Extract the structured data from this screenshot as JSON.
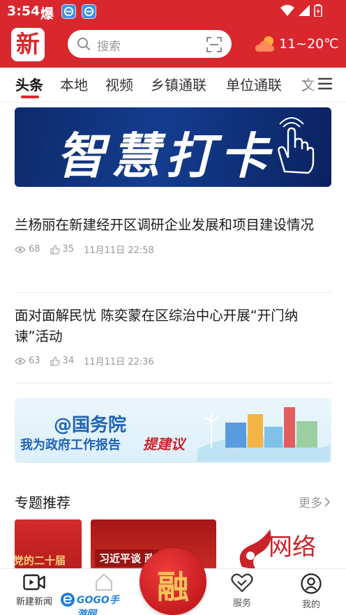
{
  "status": {
    "time": "3:54",
    "status_char": "爆"
  },
  "header": {
    "logo_char": "新",
    "search": {
      "placeholder": "搜索"
    },
    "weather": {
      "text": "11~20℃"
    }
  },
  "tabs": [
    {
      "label": "头条",
      "active": true
    },
    {
      "label": "本地"
    },
    {
      "label": "视频"
    },
    {
      "label": "乡镇通联"
    },
    {
      "label": "单位通联"
    },
    {
      "label": "文"
    }
  ],
  "banner_top": {
    "text": "智慧打卡"
  },
  "news": [
    {
      "title": "兰杨丽在新建经开区调研企业发展和项目建设情况",
      "views": "68",
      "likes": "35",
      "time": "11月11日 22:58"
    },
    {
      "title": "面对面解民忧 陈奕蒙在区综治中心开展“开门纳谏”活动",
      "views": "63",
      "likes": "34",
      "time": "11月11日 22:36"
    }
  ],
  "banner_gwy": {
    "title": "@国务院",
    "subtitle": "我为政府工作报告",
    "highlight": "提建议"
  },
  "topics": {
    "title": "专题推荐",
    "more": "更多",
    "cards": [
      {
        "text": "党的二十届"
      },
      {
        "text": "习近平谈    政"
      },
      {
        "text": "网络"
      }
    ]
  },
  "bottom_nav": {
    "items": [
      {
        "label": "新建新闻",
        "icon": "video-icon"
      },
      {
        "label": "",
        "icon": "home-icon"
      },
      {
        "label": "服务",
        "icon": "handshake-heart-icon"
      },
      {
        "label": "我的",
        "icon": "user-icon"
      }
    ],
    "fab": "融",
    "watermark": "GOGO手游网"
  },
  "colors": {
    "brand": "#d9272e",
    "accent_text": "#1f63b5"
  }
}
